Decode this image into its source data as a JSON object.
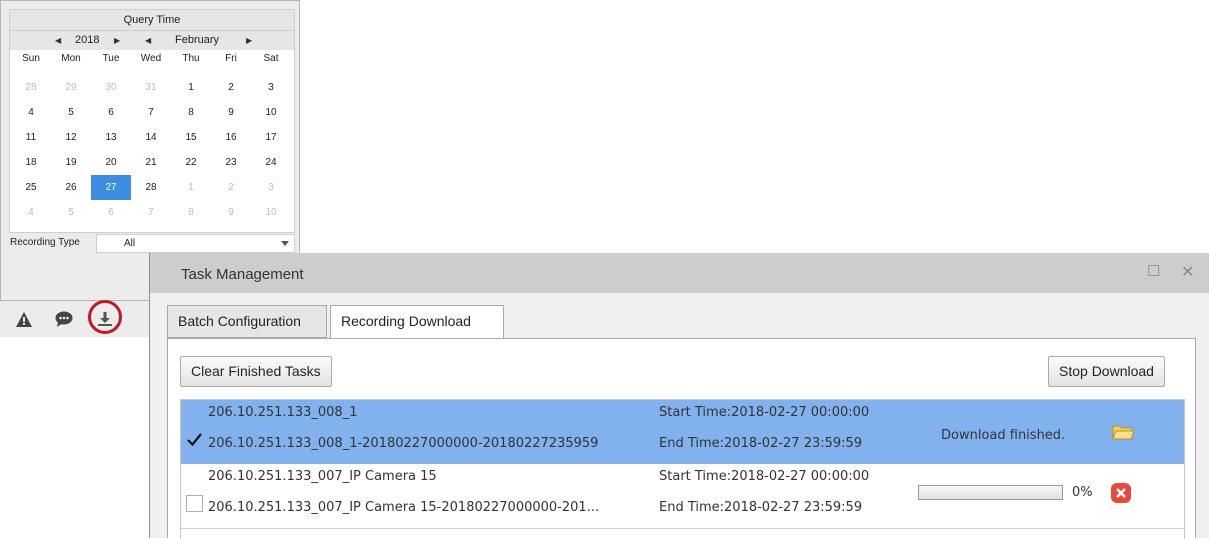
{
  "calendar": {
    "title": "Query Time",
    "year": "2018",
    "month": "February",
    "weekdays": [
      "Sun",
      "Mon",
      "Tue",
      "Wed",
      "Thu",
      "Fri",
      "Sat"
    ],
    "days": [
      {
        "d": "28",
        "muted": true
      },
      {
        "d": "29",
        "muted": true
      },
      {
        "d": "30",
        "muted": true
      },
      {
        "d": "31",
        "muted": true
      },
      {
        "d": "1"
      },
      {
        "d": "2"
      },
      {
        "d": "3"
      },
      {
        "d": "4"
      },
      {
        "d": "5"
      },
      {
        "d": "6"
      },
      {
        "d": "7"
      },
      {
        "d": "8"
      },
      {
        "d": "9"
      },
      {
        "d": "10"
      },
      {
        "d": "11"
      },
      {
        "d": "12"
      },
      {
        "d": "13"
      },
      {
        "d": "14"
      },
      {
        "d": "15"
      },
      {
        "d": "16"
      },
      {
        "d": "17"
      },
      {
        "d": "18"
      },
      {
        "d": "19"
      },
      {
        "d": "20"
      },
      {
        "d": "21"
      },
      {
        "d": "22"
      },
      {
        "d": "23"
      },
      {
        "d": "24"
      },
      {
        "d": "25"
      },
      {
        "d": "26"
      },
      {
        "d": "27",
        "selected": true
      },
      {
        "d": "28"
      },
      {
        "d": "1",
        "muted": true
      },
      {
        "d": "2",
        "muted": true
      },
      {
        "d": "3",
        "muted": true
      },
      {
        "d": "4",
        "muted": true
      },
      {
        "d": "5",
        "muted": true
      },
      {
        "d": "6",
        "muted": true
      },
      {
        "d": "7",
        "muted": true
      },
      {
        "d": "8",
        "muted": true
      },
      {
        "d": "9",
        "muted": true
      },
      {
        "d": "10",
        "muted": true
      }
    ],
    "recording_type_label": "Recording Type",
    "recording_type_value": "All",
    "selected_color": "#3d8ee0"
  },
  "toolbar_icons": [
    "alarm-icon",
    "message-icon",
    "download-icon"
  ],
  "highlight_color": "#c01824",
  "task_window": {
    "title": "Task Management",
    "tabs": [
      "Batch Configuration",
      "Recording Download"
    ],
    "active_tab": 1,
    "clear_button": "Clear Finished Tasks",
    "stop_button": "Stop Download",
    "selected_row_color": "#81b2ee",
    "tasks": [
      {
        "name": "206.10.251.133_008_1",
        "file": "206.10.251.133_008_1-20180227000000-20180227235959",
        "start": "Start Time:2018-02-27 00:00:00",
        "end": "End Time:2018-02-27 23:59:59",
        "status": "Download finished.",
        "checked": true
      },
      {
        "name": "206.10.251.133_007_IP Camera 15",
        "file": "206.10.251.133_007_IP Camera 15-20180227000000-201...",
        "start": "Start Time:2018-02-27 00:00:00",
        "end": "End Time:2018-02-27 23:59:59",
        "progress_label": "0%",
        "progress": 0,
        "checked": false
      }
    ]
  }
}
